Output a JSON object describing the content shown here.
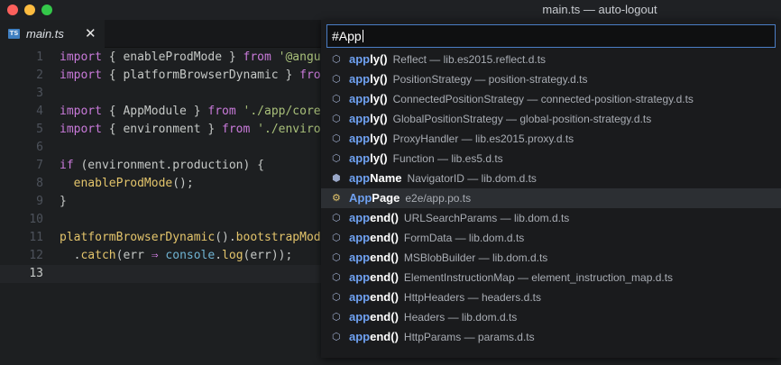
{
  "window": {
    "title": "main.ts — auto-logout"
  },
  "tab": {
    "icon_text": "TS",
    "label": "main.ts",
    "close": "✕"
  },
  "editor": {
    "lines": [
      {
        "num": "1",
        "segs": [
          [
            "kw",
            "import"
          ],
          [
            "pn",
            " { enableProdMode } "
          ],
          [
            "kw",
            "from"
          ],
          [
            "pn",
            " "
          ],
          [
            "str",
            "'@angu"
          ]
        ]
      },
      {
        "num": "2",
        "segs": [
          [
            "kw",
            "import"
          ],
          [
            "pn",
            " { platformBrowserDynamic } "
          ],
          [
            "kw",
            "fro"
          ]
        ]
      },
      {
        "num": "3",
        "segs": []
      },
      {
        "num": "4",
        "segs": [
          [
            "kw",
            "import"
          ],
          [
            "pn",
            " { AppModule } "
          ],
          [
            "kw",
            "from"
          ],
          [
            "pn",
            " "
          ],
          [
            "str",
            "'./app/core"
          ]
        ]
      },
      {
        "num": "5",
        "segs": [
          [
            "kw",
            "import"
          ],
          [
            "pn",
            " { environment } "
          ],
          [
            "kw",
            "from"
          ],
          [
            "pn",
            " "
          ],
          [
            "str",
            "'./enviro"
          ]
        ]
      },
      {
        "num": "6",
        "segs": []
      },
      {
        "num": "7",
        "segs": [
          [
            "kw",
            "if"
          ],
          [
            "pn",
            " (environment.production) {"
          ]
        ]
      },
      {
        "num": "8",
        "segs": [
          [
            "pn",
            "  "
          ],
          [
            "fn",
            "enableProdMode"
          ],
          [
            "pn",
            "();"
          ]
        ]
      },
      {
        "num": "9",
        "segs": [
          [
            "pn",
            "}"
          ]
        ]
      },
      {
        "num": "10",
        "segs": []
      },
      {
        "num": "11",
        "segs": [
          [
            "fn",
            "platformBrowserDynamic"
          ],
          [
            "pn",
            "()."
          ],
          [
            "fn",
            "bootstrapMod"
          ]
        ]
      },
      {
        "num": "12",
        "segs": [
          [
            "pn",
            "  ."
          ],
          [
            "fn",
            "catch"
          ],
          [
            "pn",
            "(err "
          ],
          [
            "kw",
            "⇒"
          ],
          [
            "pn",
            " "
          ],
          [
            "cy",
            "console"
          ],
          [
            "pn",
            "."
          ],
          [
            "fn",
            "log"
          ],
          [
            "pn",
            "(err));"
          ]
        ]
      },
      {
        "num": "13",
        "segs": [],
        "current": true
      }
    ]
  },
  "autocomplete": {
    "query": "#App",
    "items": [
      {
        "icon": "cube-icon",
        "glyph": "⬡",
        "match": "app",
        "rest": "ly()",
        "detail": "Reflect — lib.es2015.reflect.d.ts"
      },
      {
        "icon": "cube-icon",
        "glyph": "⬡",
        "match": "app",
        "rest": "ly()",
        "detail": "PositionStrategy — position-strategy.d.ts"
      },
      {
        "icon": "cube-icon",
        "glyph": "⬡",
        "match": "app",
        "rest": "ly()",
        "detail": "ConnectedPositionStrategy — connected-position-strategy.d.ts"
      },
      {
        "icon": "cube-icon",
        "glyph": "⬡",
        "match": "app",
        "rest": "ly()",
        "detail": "GlobalPositionStrategy — global-position-strategy.d.ts"
      },
      {
        "icon": "cube-icon",
        "glyph": "⬡",
        "match": "app",
        "rest": "ly()",
        "detail": "ProxyHandler — lib.es2015.proxy.d.ts"
      },
      {
        "icon": "cube-icon",
        "glyph": "⬡",
        "match": "app",
        "rest": "ly()",
        "detail": "Function — lib.es5.d.ts"
      },
      {
        "icon": "field-icon",
        "glyph": "⬢",
        "match": "app",
        "rest": "Name",
        "detail": "NavigatorID — lib.dom.d.ts"
      },
      {
        "icon": "class-icon",
        "glyph": "⚙",
        "match": "App",
        "rest": "Page",
        "detail": "e2e/app.po.ts",
        "selected": true
      },
      {
        "icon": "cube-icon",
        "glyph": "⬡",
        "match": "app",
        "rest": "end()",
        "detail": "URLSearchParams — lib.dom.d.ts"
      },
      {
        "icon": "cube-icon",
        "glyph": "⬡",
        "match": "app",
        "rest": "end()",
        "detail": "FormData — lib.dom.d.ts"
      },
      {
        "icon": "cube-icon",
        "glyph": "⬡",
        "match": "app",
        "rest": "end()",
        "detail": "MSBlobBuilder — lib.dom.d.ts"
      },
      {
        "icon": "cube-icon",
        "glyph": "⬡",
        "match": "app",
        "rest": "end()",
        "detail": "ElementInstructionMap — element_instruction_map.d.ts"
      },
      {
        "icon": "cube-icon",
        "glyph": "⬡",
        "match": "app",
        "rest": "end()",
        "detail": "HttpHeaders — headers.d.ts"
      },
      {
        "icon": "cube-icon",
        "glyph": "⬡",
        "match": "app",
        "rest": "end()",
        "detail": "Headers — lib.dom.d.ts"
      },
      {
        "icon": "cube-icon",
        "glyph": "⬡",
        "match": "app",
        "rest": "end()",
        "detail": "HttpParams — params.d.ts"
      }
    ]
  },
  "colors": {
    "accent": "#6fa1f1",
    "keyword": "#c97ada",
    "string": "#a9c07a",
    "function": "#e3c46b"
  }
}
